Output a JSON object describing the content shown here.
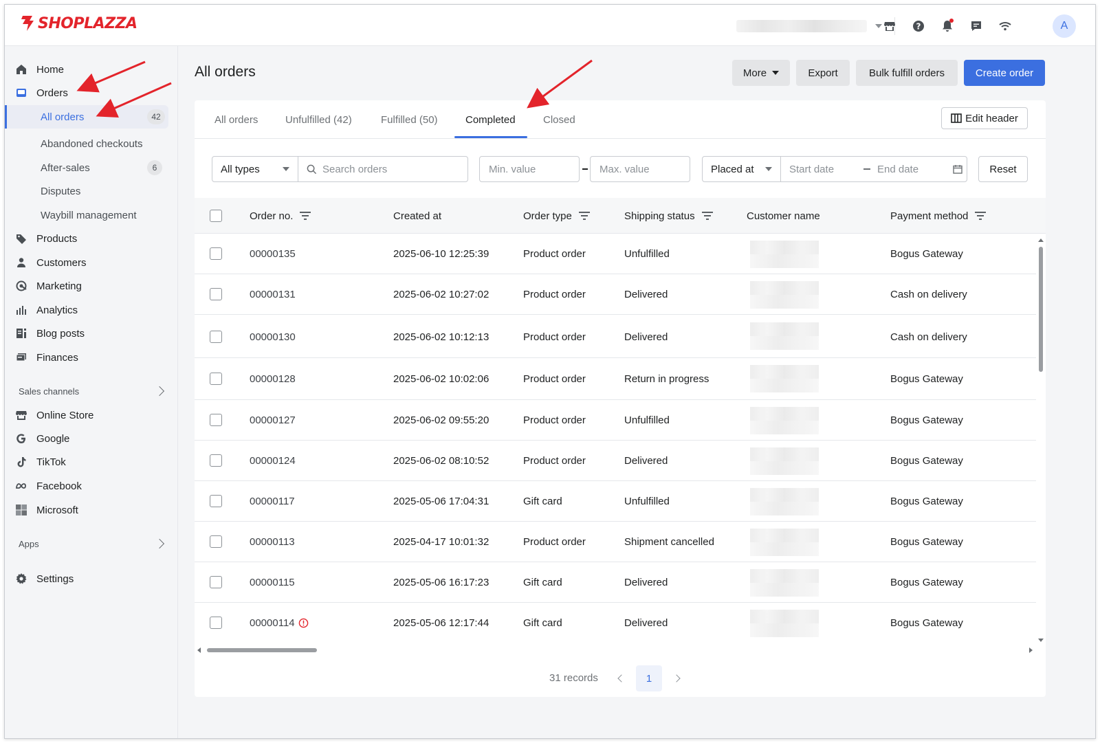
{
  "brand": {
    "name": "SHOPLAZZA",
    "color": "#e3242b",
    "accent": "#3b6fe0"
  },
  "topbar": {
    "icons": [
      "store-icon",
      "help-icon",
      "bell-icon",
      "chat-icon",
      "wifi-icon"
    ],
    "avatar_initial": "A"
  },
  "sidebar": {
    "items": [
      {
        "label": "Home",
        "icon": "home-icon"
      },
      {
        "label": "Orders",
        "icon": "orders-icon"
      },
      {
        "label": "Products",
        "icon": "tag-icon"
      },
      {
        "label": "Customers",
        "icon": "person-icon"
      },
      {
        "label": "Marketing",
        "icon": "marketing-icon"
      },
      {
        "label": "Analytics",
        "icon": "chart-icon"
      },
      {
        "label": "Blog posts",
        "icon": "blog-icon"
      },
      {
        "label": "Finances",
        "icon": "finance-icon"
      }
    ],
    "order_sub_items": [
      {
        "label": "All orders",
        "count": "42"
      },
      {
        "label": "Abandoned checkouts",
        "count": ""
      },
      {
        "label": "After-sales",
        "count": "6"
      },
      {
        "label": "Disputes",
        "count": ""
      },
      {
        "label": "Waybill management",
        "count": ""
      }
    ],
    "sales_channels_label": "Sales channels",
    "channels": [
      {
        "label": "Online Store",
        "icon": "store-icon"
      },
      {
        "label": "Google",
        "icon": "google-icon"
      },
      {
        "label": "TikTok",
        "icon": "tiktok-icon"
      },
      {
        "label": "Facebook",
        "icon": "meta-icon"
      },
      {
        "label": "Microsoft",
        "icon": "microsoft-icon"
      }
    ],
    "apps_label": "Apps",
    "settings_label": "Settings"
  },
  "header": {
    "title": "All orders",
    "more_label": "More",
    "export_label": "Export",
    "bulk_label": "Bulk fulfill orders",
    "create_label": "Create order"
  },
  "tabs": [
    {
      "label": "All orders"
    },
    {
      "label": "Unfulfilled (42)"
    },
    {
      "label": "Fulfilled (50)"
    },
    {
      "label": "Completed"
    },
    {
      "label": "Closed"
    }
  ],
  "active_tab": "Completed",
  "edit_header_label": "Edit header",
  "filters": {
    "type_value": "All types",
    "search_placeholder": "Search orders",
    "min_placeholder": "Min. value",
    "max_placeholder": "Max. value",
    "date_type": "Placed at",
    "start_placeholder": "Start date",
    "end_placeholder": "End date",
    "reset_label": "Reset"
  },
  "table": {
    "columns": [
      "Order no.",
      "Created at",
      "Order type",
      "Shipping status",
      "Customer name",
      "Payment method"
    ],
    "rows": [
      {
        "order": "00000135",
        "created": "2025-06-10 12:25:39",
        "type": "Product order",
        "shipping": "Unfulfilled",
        "payment": "Bogus Gateway"
      },
      {
        "order": "00000131",
        "created": "2025-06-02 10:27:02",
        "type": "Product order",
        "shipping": "Delivered",
        "payment": "Cash on delivery"
      },
      {
        "order": "00000130",
        "created": "2025-06-02 10:12:13",
        "type": "Product order",
        "shipping": "Delivered",
        "payment": "Cash on delivery"
      },
      {
        "order": "00000128",
        "created": "2025-06-02 10:02:06",
        "type": "Product order",
        "shipping": "Return in progress",
        "payment": "Bogus Gateway"
      },
      {
        "order": "00000127",
        "created": "2025-06-02 09:55:20",
        "type": "Product order",
        "shipping": "Unfulfilled",
        "payment": "Bogus Gateway"
      },
      {
        "order": "00000124",
        "created": "2025-06-02 08:10:52",
        "type": "Product order",
        "shipping": "Delivered",
        "payment": "Bogus Gateway"
      },
      {
        "order": "00000117",
        "created": "2025-05-06 17:04:31",
        "type": "Gift card",
        "shipping": "Unfulfilled",
        "payment": "Bogus Gateway"
      },
      {
        "order": "00000113",
        "created": "2025-04-17 10:01:32",
        "type": "Product order",
        "shipping": "Shipment cancelled",
        "payment": "Bogus Gateway"
      },
      {
        "order": "00000115",
        "created": "2025-05-06 16:17:23",
        "type": "Gift card",
        "shipping": "Delivered",
        "payment": "Bogus Gateway"
      },
      {
        "order": "00000114",
        "created": "2025-05-06 12:17:44",
        "type": "Gift card",
        "shipping": "Delivered",
        "payment": "Bogus Gateway",
        "warning": true
      }
    ]
  },
  "pagination": {
    "records": "31 records",
    "current_page": "1"
  }
}
